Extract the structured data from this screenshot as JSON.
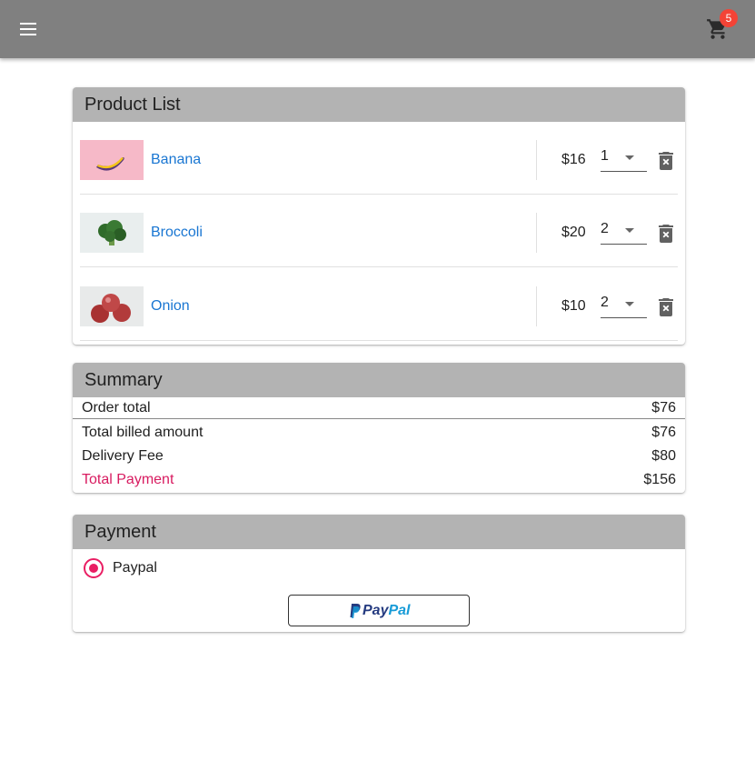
{
  "appbar": {
    "menu_icon": "menu-icon",
    "cart_icon": "shopping-cart-icon",
    "cart_count": "5",
    "colors": {
      "bar": "#808080",
      "badge": "#f44336"
    }
  },
  "product_list": {
    "title": "Product List",
    "items": [
      {
        "name": "Banana",
        "price": "$16",
        "quantity": "1",
        "image": "banana-image",
        "delete_icon": "delete-icon"
      },
      {
        "name": "Broccoli",
        "price": "$20",
        "quantity": "2",
        "image": "broccoli-image",
        "delete_icon": "delete-icon"
      },
      {
        "name": "Onion",
        "price": "$10",
        "quantity": "2",
        "image": "onion-image",
        "delete_icon": "delete-icon"
      }
    ]
  },
  "summary": {
    "title": "Summary",
    "order_total_label": "Order total",
    "order_total_value": "$76",
    "billed_label": "Total billed amount",
    "billed_value": "$76",
    "delivery_label": "Delivery Fee",
    "delivery_value": "$80",
    "payment_label": "Total Payment",
    "payment_value": "$156",
    "colors": {
      "total_label": "#d81b60"
    }
  },
  "payment": {
    "title": "Payment",
    "option_label": "Paypal",
    "option_selected": true,
    "button_text_pay": "Pay",
    "button_text_pal": "Pal",
    "colors": {
      "radio": "#e91e63",
      "pay": "#253b80",
      "pal": "#179bd7"
    }
  },
  "colors": {
    "header_bg": "#b3b3b3",
    "link": "#1976d2"
  }
}
